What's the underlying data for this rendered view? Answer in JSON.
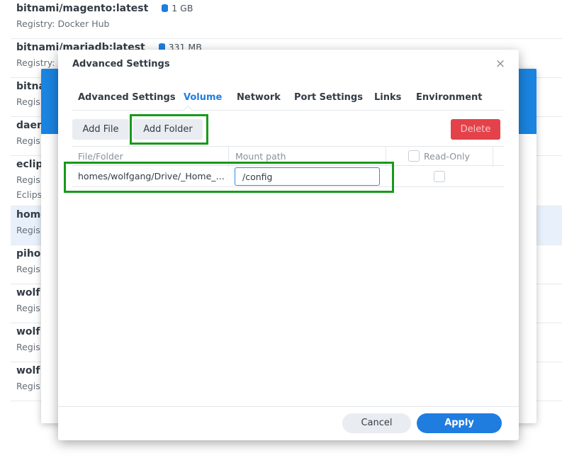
{
  "image_list": [
    {
      "name": "bitnami/magento:latest",
      "size": "1 GB",
      "registry": "Registry: Docker Hub"
    },
    {
      "name": "bitnami/mariadb:latest",
      "size": "331 MB",
      "registry": "Registry:"
    },
    {
      "name": "bitna",
      "registry": "Regis"
    },
    {
      "name": "daem",
      "registry": "Regis"
    },
    {
      "name": "eclip",
      "registry": "Regis",
      "extra": "Eclips"
    },
    {
      "name": "home",
      "registry": "Regis"
    },
    {
      "name": "pihol",
      "registry": "Regis"
    },
    {
      "name": "wolf",
      "registry": "Regis"
    },
    {
      "name": "wolf",
      "registry": "Regis"
    },
    {
      "name": "wolf",
      "registry": "Regis"
    }
  ],
  "dialog": {
    "title": "Advanced Settings",
    "close_icon": "×",
    "tabs": [
      {
        "label": "Advanced Settings"
      },
      {
        "label": "Volume"
      },
      {
        "label": "Network"
      },
      {
        "label": "Port Settings"
      },
      {
        "label": "Links"
      },
      {
        "label": "Environment"
      }
    ],
    "active_tab": "Volume",
    "toolbar": {
      "add_file": "Add File",
      "add_folder": "Add Folder",
      "delete": "Delete"
    },
    "table": {
      "headers": {
        "file_folder": "File/Folder",
        "mount_path": "Mount path",
        "read_only": "Read-Only"
      },
      "rows": [
        {
          "file_folder": "homes/wolfgang/Drive/_Home_Assistant",
          "mount_path": "/config",
          "read_only": false
        }
      ]
    },
    "footer": {
      "cancel": "Cancel",
      "apply": "Apply"
    }
  },
  "colors": {
    "accent": "#1f7de0",
    "highlight": "#179a1a",
    "danger": "#e4424a"
  }
}
